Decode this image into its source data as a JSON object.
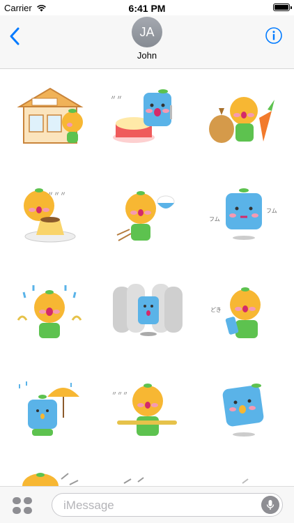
{
  "status_bar": {
    "carrier": "Carrier",
    "time": "6:41 PM",
    "battery_level": 1.0
  },
  "nav": {
    "avatar_initials": "JA",
    "contact_name": "John"
  },
  "compose": {
    "placeholder": "iMessage"
  },
  "stickers": [
    {
      "icon": "house-sticker-icon"
    },
    {
      "icon": "cake-sticker-icon"
    },
    {
      "icon": "vegetables-sticker-icon"
    },
    {
      "icon": "pudding-sticker-icon"
    },
    {
      "icon": "rice-sticker-icon"
    },
    {
      "icon": "blue-cube-sticker-icon"
    },
    {
      "icon": "crying-sticker-icon"
    },
    {
      "icon": "ghosts-sticker-icon"
    },
    {
      "icon": "phone-sticker-icon"
    },
    {
      "icon": "umbrella-sticker-icon"
    },
    {
      "icon": "flute-sticker-icon"
    },
    {
      "icon": "blue-cube-crying-sticker-icon"
    },
    {
      "icon": "partial-sticker-icon"
    },
    {
      "icon": "partial-sticker-icon"
    },
    {
      "icon": "partial-sticker-icon"
    }
  ],
  "colors": {
    "accent": "#007aff",
    "orange": "#f7b733",
    "green": "#5dc24f",
    "blue": "#5ab3e8",
    "blush": "#f59ab3",
    "mouth": "#d42a6a"
  }
}
